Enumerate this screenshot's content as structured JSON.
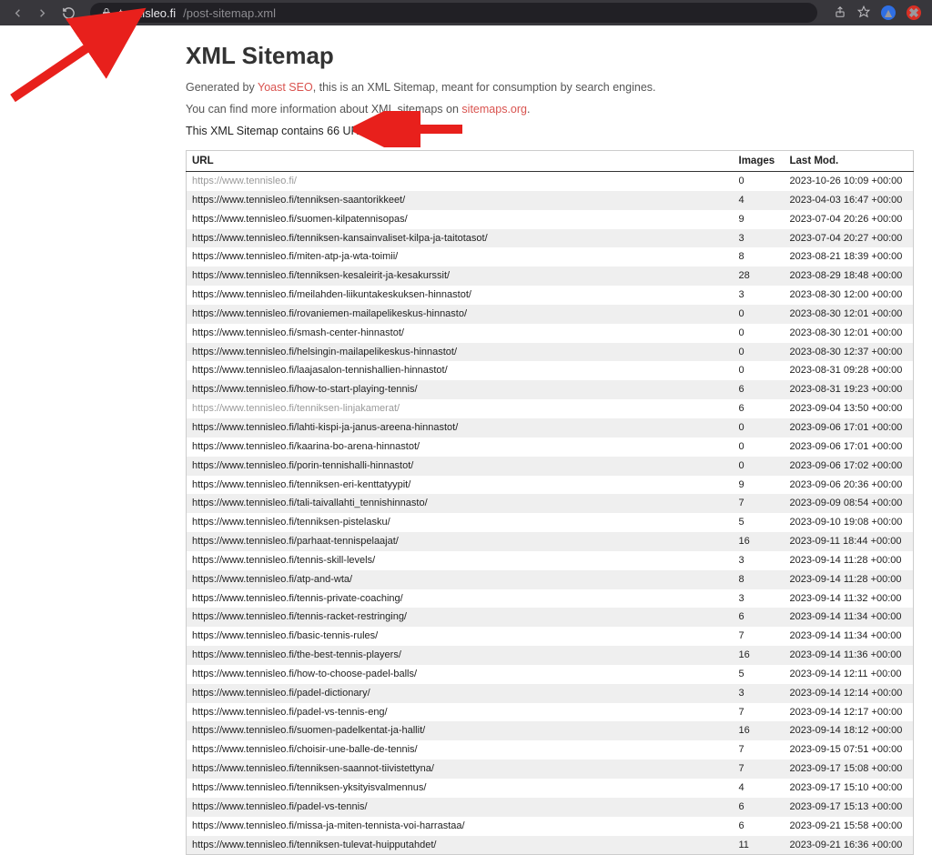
{
  "browser": {
    "url_host": "tennisleo.fi",
    "url_path": "/post-sitemap.xml"
  },
  "page": {
    "title": "XML Sitemap",
    "generated_prefix": "Generated by ",
    "generated_link": "Yoast SEO",
    "generated_suffix": ", this is an XML Sitemap, meant for consumption by search engines.",
    "info_prefix": "You can find more information about XML sitemaps on ",
    "info_link": "sitemaps.org",
    "info_suffix": ".",
    "summary": "This XML Sitemap contains 66 URLs."
  },
  "table": {
    "headers": {
      "url": "URL",
      "images": "Images",
      "lastmod": "Last Mod."
    },
    "rows": [
      {
        "url": "https://www.tennisleo.fi/",
        "images": "0",
        "lastmod": "2023-10-26 10:09 +00:00",
        "faded": true
      },
      {
        "url": "https://www.tennisleo.fi/tenniksen-saantorikkeet/",
        "images": "4",
        "lastmod": "2023-04-03 16:47 +00:00"
      },
      {
        "url": "https://www.tennisleo.fi/suomen-kilpatennisopas/",
        "images": "9",
        "lastmod": "2023-07-04 20:26 +00:00"
      },
      {
        "url": "https://www.tennisleo.fi/tenniksen-kansainvaliset-kilpa-ja-taitotasot/",
        "images": "3",
        "lastmod": "2023-07-04 20:27 +00:00"
      },
      {
        "url": "https://www.tennisleo.fi/miten-atp-ja-wta-toimii/",
        "images": "8",
        "lastmod": "2023-08-21 18:39 +00:00"
      },
      {
        "url": "https://www.tennisleo.fi/tenniksen-kesaleirit-ja-kesakurssit/",
        "images": "28",
        "lastmod": "2023-08-29 18:48 +00:00"
      },
      {
        "url": "https://www.tennisleo.fi/meilahden-liikuntakeskuksen-hinnastot/",
        "images": "3",
        "lastmod": "2023-08-30 12:00 +00:00"
      },
      {
        "url": "https://www.tennisleo.fi/rovaniemen-mailapelikeskus-hinnasto/",
        "images": "0",
        "lastmod": "2023-08-30 12:01 +00:00"
      },
      {
        "url": "https://www.tennisleo.fi/smash-center-hinnastot/",
        "images": "0",
        "lastmod": "2023-08-30 12:01 +00:00"
      },
      {
        "url": "https://www.tennisleo.fi/helsingin-mailapelikeskus-hinnastot/",
        "images": "0",
        "lastmod": "2023-08-30 12:37 +00:00"
      },
      {
        "url": "https://www.tennisleo.fi/laajasalon-tennishallien-hinnastot/",
        "images": "0",
        "lastmod": "2023-08-31 09:28 +00:00"
      },
      {
        "url": "https://www.tennisleo.fi/how-to-start-playing-tennis/",
        "images": "6",
        "lastmod": "2023-08-31 19:23 +00:00"
      },
      {
        "url": "https://www.tennisleo.fi/tenniksen-linjakamerat/",
        "images": "6",
        "lastmod": "2023-09-04 13:50 +00:00",
        "faded": true
      },
      {
        "url": "https://www.tennisleo.fi/lahti-kispi-ja-janus-areena-hinnastot/",
        "images": "0",
        "lastmod": "2023-09-06 17:01 +00:00"
      },
      {
        "url": "https://www.tennisleo.fi/kaarina-bo-arena-hinnastot/",
        "images": "0",
        "lastmod": "2023-09-06 17:01 +00:00"
      },
      {
        "url": "https://www.tennisleo.fi/porin-tennishalli-hinnastot/",
        "images": "0",
        "lastmod": "2023-09-06 17:02 +00:00"
      },
      {
        "url": "https://www.tennisleo.fi/tenniksen-eri-kenttatyypit/",
        "images": "9",
        "lastmod": "2023-09-06 20:36 +00:00"
      },
      {
        "url": "https://www.tennisleo.fi/tali-taivallahti_tennishinnasto/",
        "images": "7",
        "lastmod": "2023-09-09 08:54 +00:00"
      },
      {
        "url": "https://www.tennisleo.fi/tenniksen-pistelasku/",
        "images": "5",
        "lastmod": "2023-09-10 19:08 +00:00"
      },
      {
        "url": "https://www.tennisleo.fi/parhaat-tennispelaajat/",
        "images": "16",
        "lastmod": "2023-09-11 18:44 +00:00"
      },
      {
        "url": "https://www.tennisleo.fi/tennis-skill-levels/",
        "images": "3",
        "lastmod": "2023-09-14 11:28 +00:00"
      },
      {
        "url": "https://www.tennisleo.fi/atp-and-wta/",
        "images": "8",
        "lastmod": "2023-09-14 11:28 +00:00"
      },
      {
        "url": "https://www.tennisleo.fi/tennis-private-coaching/",
        "images": "3",
        "lastmod": "2023-09-14 11:32 +00:00"
      },
      {
        "url": "https://www.tennisleo.fi/tennis-racket-restringing/",
        "images": "6",
        "lastmod": "2023-09-14 11:34 +00:00"
      },
      {
        "url": "https://www.tennisleo.fi/basic-tennis-rules/",
        "images": "7",
        "lastmod": "2023-09-14 11:34 +00:00"
      },
      {
        "url": "https://www.tennisleo.fi/the-best-tennis-players/",
        "images": "16",
        "lastmod": "2023-09-14 11:36 +00:00"
      },
      {
        "url": "https://www.tennisleo.fi/how-to-choose-padel-balls/",
        "images": "5",
        "lastmod": "2023-09-14 12:11 +00:00"
      },
      {
        "url": "https://www.tennisleo.fi/padel-dictionary/",
        "images": "3",
        "lastmod": "2023-09-14 12:14 +00:00"
      },
      {
        "url": "https://www.tennisleo.fi/padel-vs-tennis-eng/",
        "images": "7",
        "lastmod": "2023-09-14 12:17 +00:00"
      },
      {
        "url": "https://www.tennisleo.fi/suomen-padelkentat-ja-hallit/",
        "images": "16",
        "lastmod": "2023-09-14 18:12 +00:00"
      },
      {
        "url": "https://www.tennisleo.fi/choisir-une-balle-de-tennis/",
        "images": "7",
        "lastmod": "2023-09-15 07:51 +00:00"
      },
      {
        "url": "https://www.tennisleo.fi/tenniksen-saannot-tiivistettyna/",
        "images": "7",
        "lastmod": "2023-09-17 15:08 +00:00"
      },
      {
        "url": "https://www.tennisleo.fi/tenniksen-yksityisvalmennus/",
        "images": "4",
        "lastmod": "2023-09-17 15:10 +00:00"
      },
      {
        "url": "https://www.tennisleo.fi/padel-vs-tennis/",
        "images": "6",
        "lastmod": "2023-09-17 15:13 +00:00"
      },
      {
        "url": "https://www.tennisleo.fi/missa-ja-miten-tennista-voi-harrastaa/",
        "images": "6",
        "lastmod": "2023-09-21 15:58 +00:00"
      },
      {
        "url": "https://www.tennisleo.fi/tenniksen-tulevat-huipputahdet/",
        "images": "11",
        "lastmod": "2023-09-21 16:36 +00:00"
      }
    ]
  }
}
